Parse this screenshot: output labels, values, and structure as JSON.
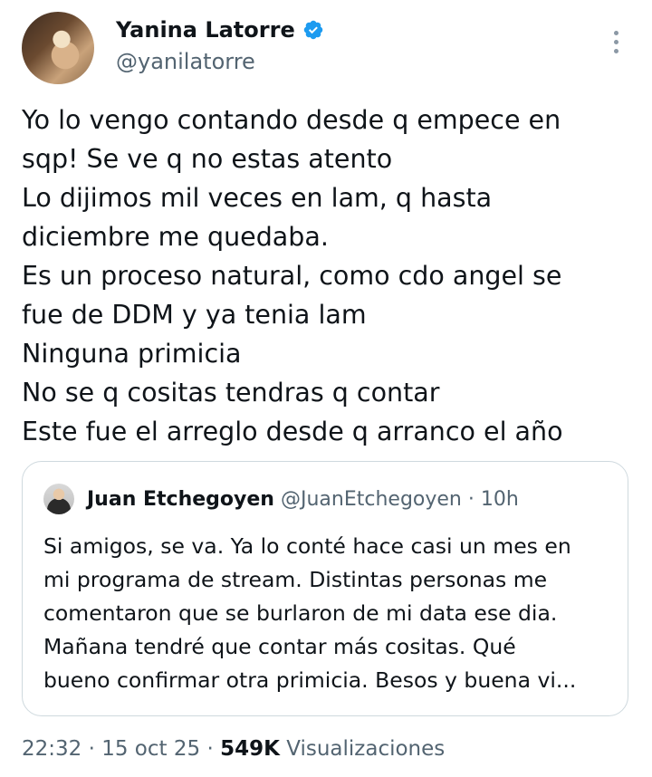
{
  "author": {
    "name": "Yanina Latorre",
    "handle": "@yanilatorre",
    "verified_color": "#1d9bf0"
  },
  "icons": {
    "verified": "verified-badge-icon",
    "more": "more-options-icon"
  },
  "tweet": {
    "lines": [
      "Yo lo vengo contando desde q empece en",
      "sqp! Se ve q no estas atento",
      "Lo dijimos mil veces en lam, q hasta",
      "diciembre me quedaba.",
      "Es un proceso natural, como cdo angel se",
      "fue de DDM y ya tenia lam",
      "Ninguna primicia",
      "No se q cositas tendras q contar",
      "Este fue el arreglo desde q arranco el año"
    ]
  },
  "quote": {
    "name": "Juan Etchegoyen",
    "handle": "@JuanEtchegoyen",
    "separator": "·",
    "time": "10h",
    "lines": [
      "Si amigos, se va. Ya lo conté hace casi un mes en",
      "mi programa de stream. Distintas personas me",
      "comentaron que se burlaron de mi data ese dia.",
      "Mañana tendré que contar más cositas. Qué",
      "bueno confirmar otra primicia. Besos y buena vi..."
    ]
  },
  "meta": {
    "time": "22:32",
    "date": "15 oct 25",
    "separator": "·",
    "views_count": "549K",
    "views_label": "Visualizaciones"
  }
}
